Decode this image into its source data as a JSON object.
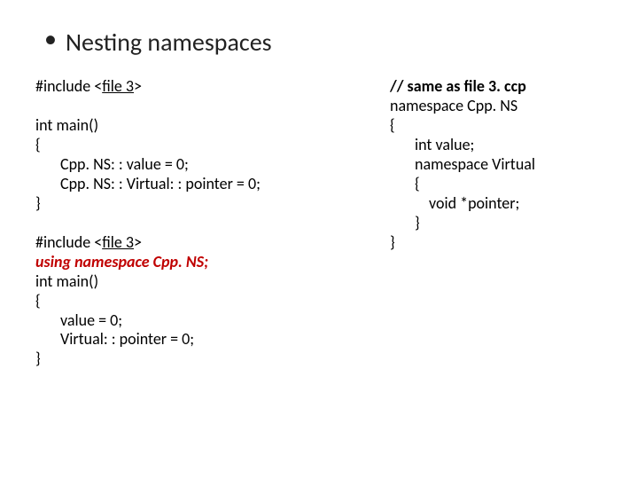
{
  "title": "Nesting namespaces",
  "left": {
    "inc1_a": "#include <",
    "inc1_b": "file 3",
    "inc1_c": ">",
    "l1": "int main()",
    "l2": "{",
    "l3": "Cpp. NS: : value = 0;",
    "l4": "Cpp. NS: : Virtual: : pointer = 0;",
    "l5": "}",
    "inc2_a": "#include <",
    "inc2_b": "file 3",
    "inc2_c": ">",
    "using": "using namespace Cpp. NS;",
    "m1": "int main()",
    "m2": "{",
    "m3": "value = 0;",
    "m4": "Virtual: : pointer = 0;",
    "m5": "}"
  },
  "right": {
    "c0": "// same as file 3. ccp",
    "c1": "namespace Cpp. NS",
    "c2": "{",
    "c3": "int value;",
    "c4": "namespace Virtual",
    "c5": "{",
    "c6": "void *pointer;",
    "c7": "}",
    "c8": "}"
  }
}
